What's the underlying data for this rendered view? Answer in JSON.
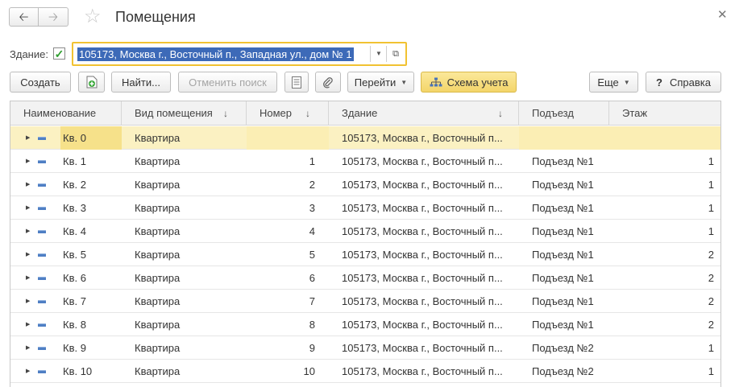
{
  "window": {
    "title": "Помещения",
    "back_icon": "arrow-left-icon",
    "forward_icon": "arrow-right-icon",
    "favorite_icon": "star-icon",
    "close_icon": "close-icon"
  },
  "filter": {
    "label": "Здание:",
    "checked": true,
    "value": "105173, Москва г., Восточный п., Западная ул., дом № 1"
  },
  "toolbar": {
    "create": "Создать",
    "add_copy_icon": "add-document-icon",
    "find": "Найти...",
    "cancel_search": "Отменить поиск",
    "list_icon": "list-icon",
    "attach_icon": "paperclip-icon",
    "goto": "Перейти",
    "scheme": "Схема учета",
    "more": "Еще",
    "help_symbol": "?",
    "help": "Справка"
  },
  "table": {
    "columns": [
      "Наименование",
      "Вид помещения",
      "Номер",
      "Здание",
      "Подъезд",
      "Этаж"
    ],
    "rows": [
      {
        "name": "Кв. 0",
        "type": "Квартира",
        "number": "",
        "building": "105173, Москва г., Восточный п...",
        "entrance": "",
        "floor": ""
      },
      {
        "name": "Кв. 1",
        "type": "Квартира",
        "number": "1",
        "building": "105173, Москва г., Восточный п...",
        "entrance": "Подъезд №1",
        "floor": "1"
      },
      {
        "name": "Кв. 2",
        "type": "Квартира",
        "number": "2",
        "building": "105173, Москва г., Восточный п...",
        "entrance": "Подъезд №1",
        "floor": "1"
      },
      {
        "name": "Кв. 3",
        "type": "Квартира",
        "number": "3",
        "building": "105173, Москва г., Восточный п...",
        "entrance": "Подъезд №1",
        "floor": "1"
      },
      {
        "name": "Кв. 4",
        "type": "Квартира",
        "number": "4",
        "building": "105173, Москва г., Восточный п...",
        "entrance": "Подъезд №1",
        "floor": "1"
      },
      {
        "name": "Кв. 5",
        "type": "Квартира",
        "number": "5",
        "building": "105173, Москва г., Восточный п...",
        "entrance": "Подъезд №1",
        "floor": "2"
      },
      {
        "name": "Кв. 6",
        "type": "Квартира",
        "number": "6",
        "building": "105173, Москва г., Восточный п...",
        "entrance": "Подъезд №1",
        "floor": "2"
      },
      {
        "name": "Кв. 7",
        "type": "Квартира",
        "number": "7",
        "building": "105173, Москва г., Восточный п...",
        "entrance": "Подъезд №1",
        "floor": "2"
      },
      {
        "name": "Кв. 8",
        "type": "Квартира",
        "number": "8",
        "building": "105173, Москва г., Восточный п...",
        "entrance": "Подъезд №1",
        "floor": "2"
      },
      {
        "name": "Кв. 9",
        "type": "Квартира",
        "number": "9",
        "building": "105173, Москва г., Восточный п...",
        "entrance": "Подъезд №2",
        "floor": "1"
      },
      {
        "name": "Кв. 10",
        "type": "Квартира",
        "number": "10",
        "building": "105173, Москва г., Восточный п...",
        "entrance": "Подъезд №2",
        "floor": "1"
      }
    ]
  },
  "colors": {
    "accent_border": "#f1c232",
    "selected_row": "#fbf1c2",
    "selection_text_bg": "#3d6ab8",
    "scheme_button": "#f3d56a"
  }
}
